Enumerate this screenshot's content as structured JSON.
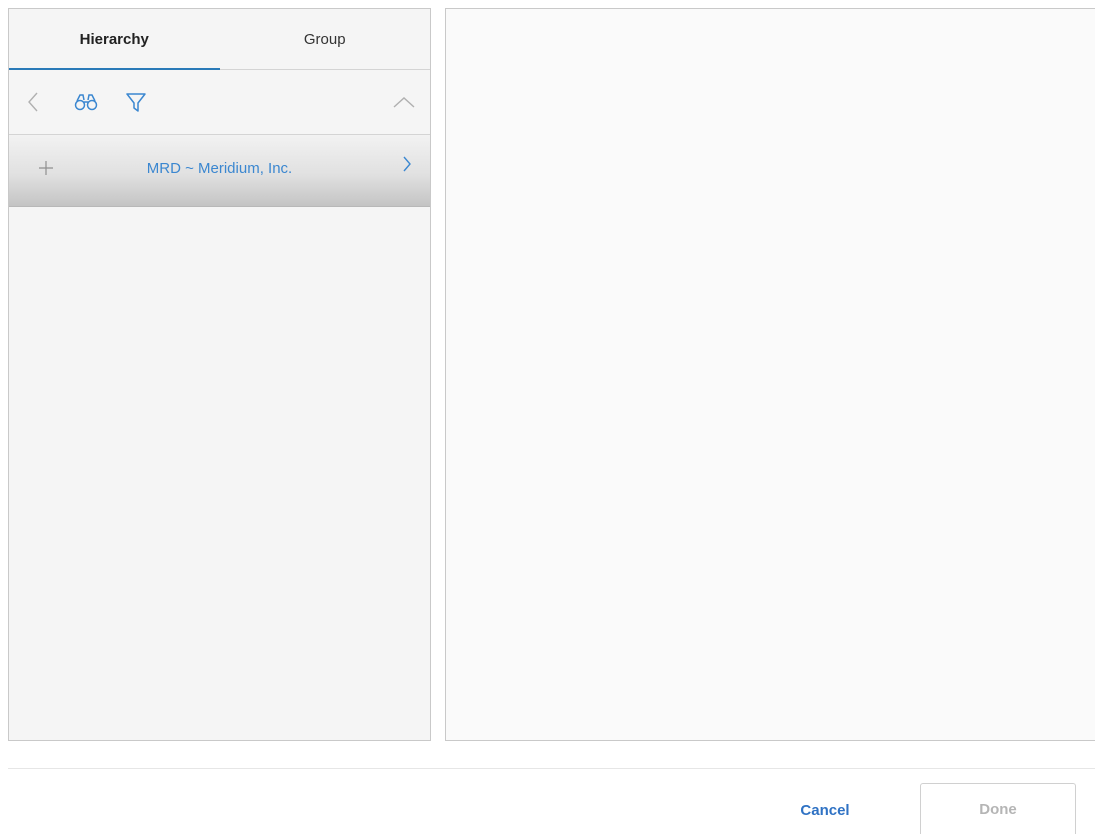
{
  "nav": {
    "tabs": [
      {
        "label": "Hierarchy",
        "active": true
      },
      {
        "label": "Group",
        "active": false
      }
    ],
    "toolbar": {
      "back_icon": "chevron-left-icon",
      "search_icon": "binoculars-icon",
      "filter_icon": "funnel-icon",
      "collapse_icon": "chevron-up-icon"
    },
    "tree": {
      "items": [
        {
          "label": "MRD ~ Meridium, Inc.",
          "expand_icon": "plus-icon",
          "next_icon": "chevron-right-icon"
        }
      ]
    }
  },
  "footer": {
    "cancel_label": "Cancel",
    "done_label": "Done"
  },
  "colors": {
    "accent": "#3b87d0",
    "tab_underline": "#2a7ab8",
    "button_text": "#2f72c4",
    "disabled_text": "#b5b5b5",
    "icon_gray": "#8f8f8f"
  }
}
